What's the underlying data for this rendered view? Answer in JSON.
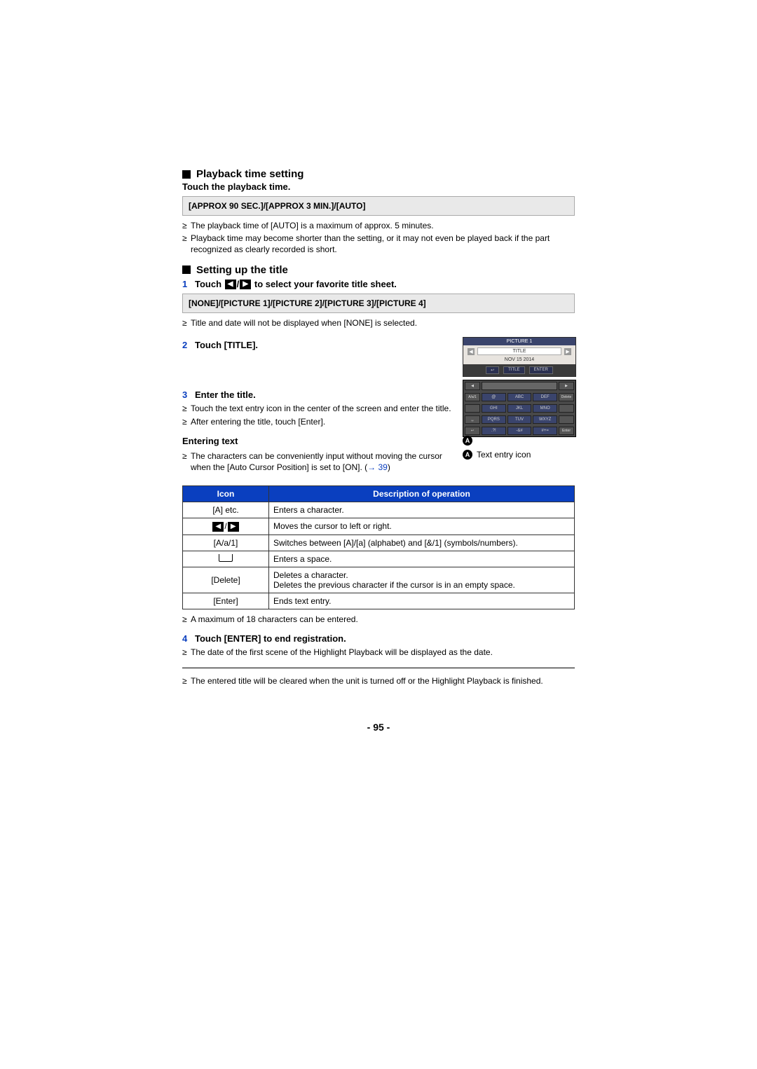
{
  "sections": {
    "playback": {
      "heading": "Playback time setting",
      "instruction": "Touch the playback time.",
      "options": "[APPROX 90 SEC.]/[APPROX 3 MIN.]/[AUTO]",
      "bullets": [
        "The playback time of [AUTO] is a maximum of approx. 5 minutes.",
        "Playback time may become shorter than the setting, or it may not even be played back if the part recognized as clearly recorded is short."
      ]
    },
    "title_setup": {
      "heading": "Setting up the title",
      "step1_num": "1",
      "step1_pre": "Touch ",
      "step1_post": " to select your favorite title sheet.",
      "title_options": "[NONE]/[PICTURE 1]/[PICTURE 2]/[PICTURE 3]/[PICTURE 4]",
      "title_note": "Title and date will not be displayed when [NONE] is selected.",
      "step2_num": "2",
      "step2_text": "Touch [TITLE].",
      "step3_num": "3",
      "step3_text": "Enter the title.",
      "step3_bul1": "Touch the text entry icon in the center of the screen and enter the title.",
      "step3_bul2": "After entering the title, touch [Enter].",
      "entering_head": "Entering text",
      "entering_bul_pre": "The characters can be conveniently input without moving the cursor when the [Auto Cursor Position] is set to [ON]. (",
      "entering_bul_arrow": "→",
      "entering_bul_link": "39",
      "entering_bul_post": ")",
      "legend_label": "A",
      "legend_text": "Text entry icon"
    },
    "screenshot1": {
      "hdr": "PICTURE 1",
      "title": "TITLE",
      "date": "NOV 15 2014",
      "back": "↩",
      "btn_title": "TITLE",
      "enter": "ENTER",
      "arr_l": "◀",
      "arr_r": "▶"
    },
    "screenshot2": {
      "side_mode": "A/a/1",
      "side_del": "Delete",
      "side_space": "␣",
      "side_back": "↩",
      "side_enter": "Enter",
      "arr_l": "◀",
      "arr_r": "▶",
      "r1": [
        "@",
        "ABC",
        "DEF"
      ],
      "r2": [
        "GHI",
        "JKL",
        "MNO"
      ],
      "r3": [
        "PQRS",
        "TUV",
        "WXYZ"
      ],
      "r4": [
        ".?!",
        "-&#",
        "#+="
      ]
    },
    "table": {
      "th_icon": "Icon",
      "th_desc": "Description of operation",
      "rows": [
        {
          "icon": "[A] etc.",
          "desc": "Enters a character."
        },
        {
          "icon": "ARROWS",
          "desc": "Moves the cursor to left or right."
        },
        {
          "icon": "[A/a/1]",
          "desc": "Switches between [A]/[a] (alphabet) and [&/1] (symbols/numbers)."
        },
        {
          "icon": "SPACE",
          "desc": "Enters a space."
        },
        {
          "icon": "[Delete]",
          "desc": "Deletes a character.\nDeletes the previous character if the cursor is in an empty space."
        },
        {
          "icon": "[Enter]",
          "desc": "Ends text entry."
        }
      ]
    },
    "after_table": {
      "max_note": "A maximum of 18 characters can be entered.",
      "step4_num": "4",
      "step4_text": "Touch [ENTER] to end registration.",
      "step4_bul": "The date of the first scene of the Highlight Playback will be displayed as the date.",
      "final_bul": "The entered title will be cleared when the unit is turned off or the Highlight Playback is finished."
    }
  },
  "page_number": "- 95 -"
}
